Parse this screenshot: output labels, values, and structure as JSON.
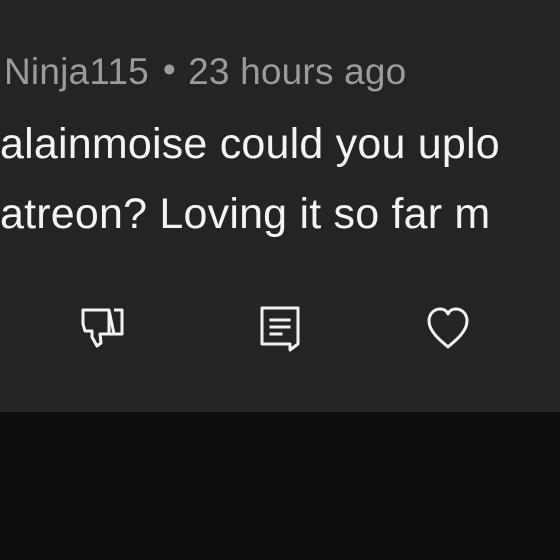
{
  "comment": {
    "author": "Ninja115",
    "separator": "•",
    "timestamp": "23 hours ago",
    "body_lines": [
      "alainmoise could you uplo",
      "atreon? Loving it so far m"
    ]
  },
  "actions": [
    {
      "icon": "thumbs-down-icon"
    },
    {
      "icon": "comment-icon"
    },
    {
      "icon": "heart-icon"
    }
  ],
  "colors": {
    "card_background": "#242424",
    "page_background": "#0e0e0e",
    "meta_text": "#9b9b9b",
    "body_text": "#f4f4f4",
    "icon_stroke": "#f2f2f2"
  }
}
